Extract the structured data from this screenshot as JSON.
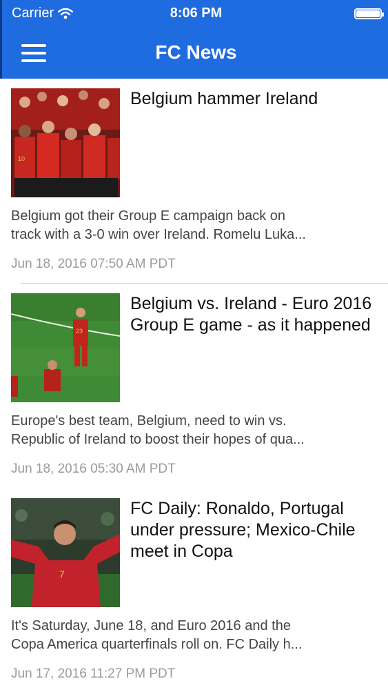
{
  "status_bar": {
    "carrier": "Carrier",
    "time": "8:06 PM"
  },
  "navbar": {
    "title": "FC News",
    "menu_icon": "hamburger-menu-icon"
  },
  "articles": [
    {
      "headline": "Belgium hammer Ireland",
      "summary_line1": "Belgium got their Group E campaign back on",
      "summary_line2": "track with a 3-0 win over Ireland. Romelu Luka...",
      "date": "Jun 18, 2016 07:50 AM PDT"
    },
    {
      "headline": "Belgium vs. Ireland - Euro 2016 Group E game - as it happened",
      "summary_line1": "Europe's best team, Belgium, need to win vs.",
      "summary_line2": "Republic of Ireland to boost their hopes of qua...",
      "date": "Jun 18, 2016 05:30 AM PDT"
    },
    {
      "headline": "FC Daily: Ronaldo, Portugal under pressure; Mexico-Chile meet in Copa",
      "summary_line1": "It's Saturday, June 18, and Euro 2016 and the",
      "summary_line2": "Copa America quarterfinals roll on. FC Daily h...",
      "date": "Jun 17, 2016 11:27 PM PDT"
    }
  ],
  "colors": {
    "nav": "#1f6be0",
    "summary": "#444444",
    "date": "#9b9b9b"
  }
}
